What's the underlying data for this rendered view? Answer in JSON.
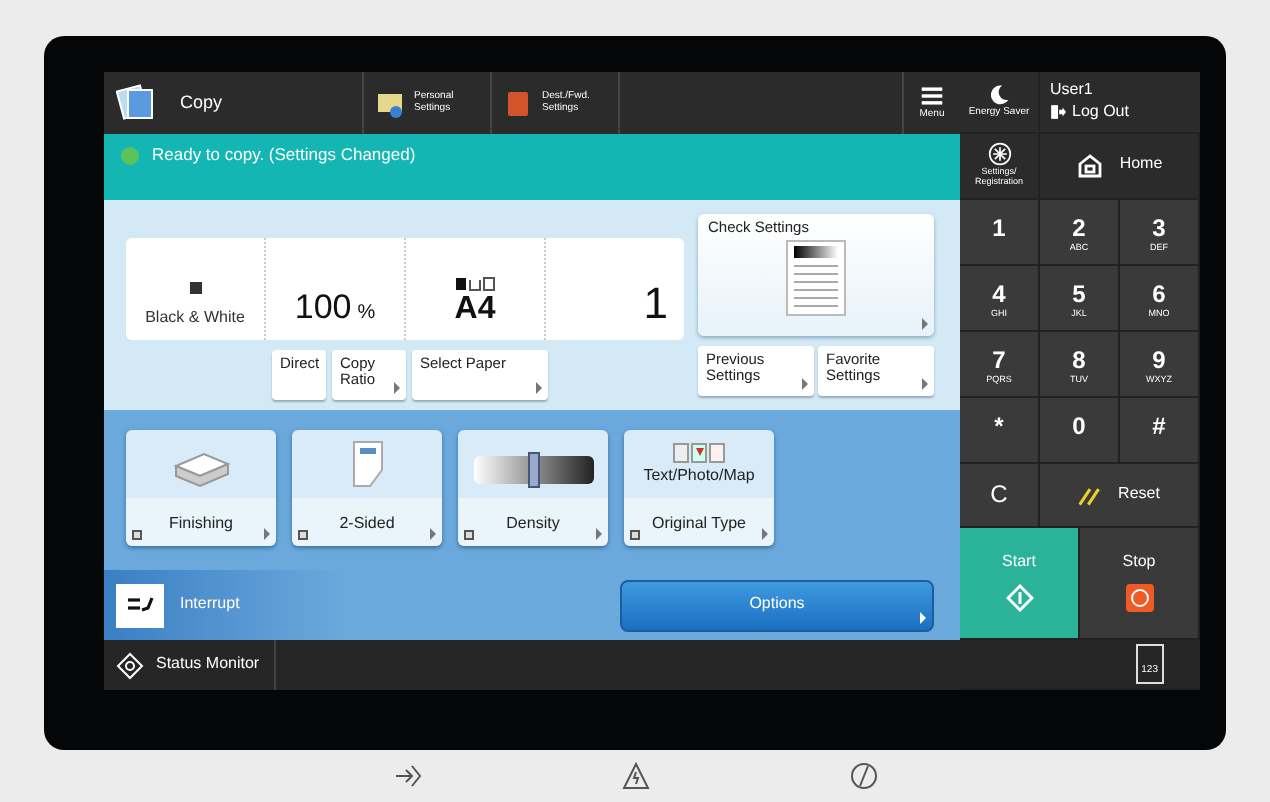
{
  "top_bar": {
    "app": "Copy",
    "shortcuts": [
      {
        "label": "Personal\nSettings",
        "kind": "personal"
      },
      {
        "label": "Dest./Fwd.\nSettings",
        "kind": "dest"
      }
    ],
    "menu": "Menu"
  },
  "status": "Ready to copy. (Settings Changed)",
  "summary": {
    "color_mode": "Black & White",
    "ratio": "100",
    "ratio_unit": "%",
    "paper": "A4",
    "copies": "1"
  },
  "summary_buttons": [
    {
      "label": "Direct",
      "arrow": false
    },
    {
      "label": "Copy\nRatio",
      "arrow": true
    },
    {
      "label": "Select Paper",
      "arrow": true
    }
  ],
  "check_settings": "Check Settings",
  "settings_buttons": [
    {
      "label": "Previous\nSettings"
    },
    {
      "label": "Favorite\nSettings"
    }
  ],
  "functions": [
    {
      "kind": "finishing",
      "label": "Finishing"
    },
    {
      "kind": "duplex",
      "label": "2-Sided"
    },
    {
      "kind": "density",
      "label": "Density",
      "level": 0.5
    },
    {
      "kind": "original",
      "label": "Original Type",
      "value": "Text/Photo/Map"
    }
  ],
  "interrupt": "Interrupt",
  "options": "Options",
  "status_monitor": "Status Monitor",
  "keypad": {
    "energy_saver": "Energy Saver",
    "user": "User1",
    "logout": "Log Out",
    "settings": "Settings/\nRegistration",
    "home": "Home",
    "keys": [
      {
        "main": "1"
      },
      {
        "main": "2",
        "sub": "ABC"
      },
      {
        "main": "3",
        "sub": "DEF"
      },
      {
        "main": "4",
        "sub": "GHI"
      },
      {
        "main": "5",
        "sub": "JKL"
      },
      {
        "main": "6",
        "sub": "MNO"
      },
      {
        "main": "7",
        "sub": "PQRS"
      },
      {
        "main": "8",
        "sub": "TUV"
      },
      {
        "main": "9",
        "sub": "WXYZ"
      },
      {
        "main": "*"
      },
      {
        "main": "0"
      },
      {
        "main": "#"
      }
    ],
    "clear": "C",
    "reset": "Reset",
    "start": "Start",
    "stop": "Stop",
    "numeric": "123"
  }
}
